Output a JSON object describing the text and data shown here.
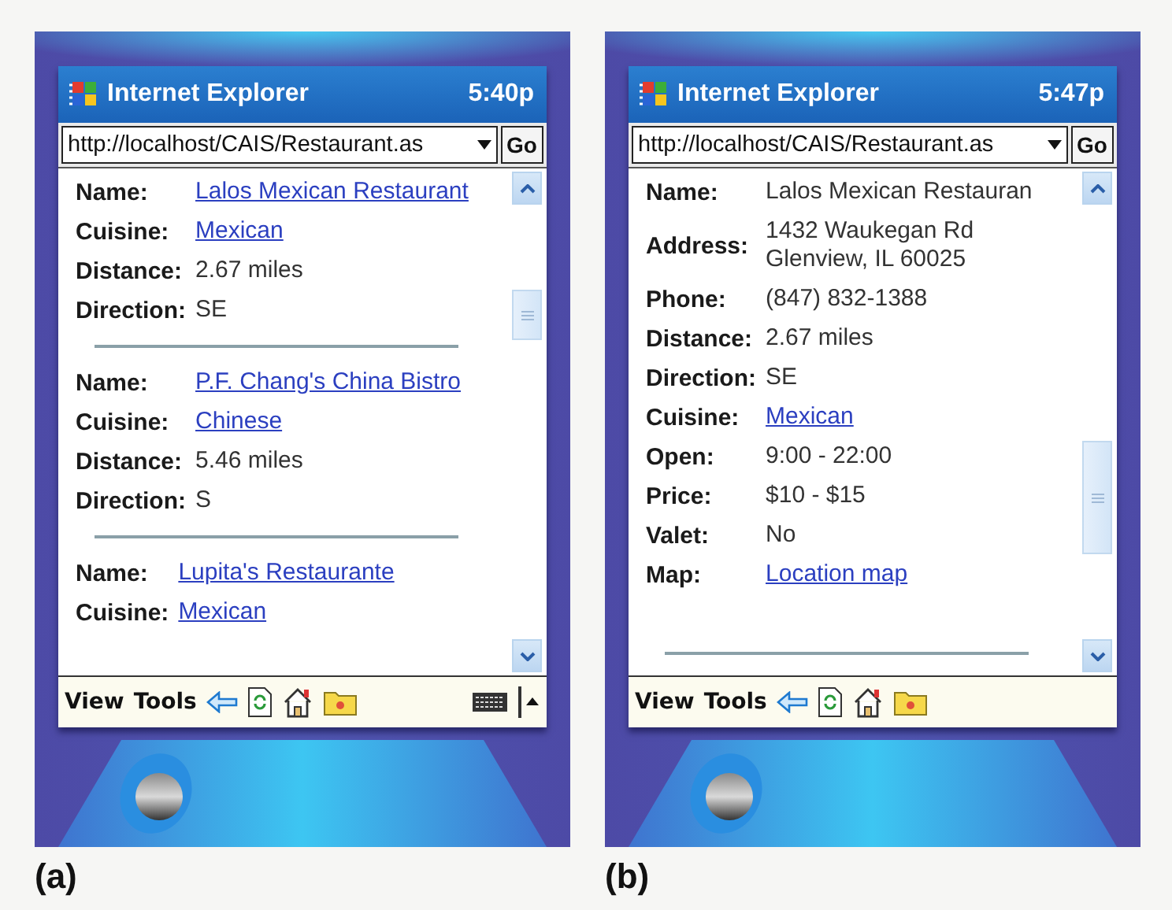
{
  "panels": [
    {
      "label": "(a)",
      "title": "Internet Explorer",
      "time": "5:40p",
      "address": "http://localhost/CAIS/Restaurant.as",
      "go": "Go",
      "trailing_rule": false,
      "input_panel": true,
      "records": [
        {
          "fields": [
            {
              "label": "Name:",
              "value": "Lalos Mexican Restaurant",
              "kind": "link"
            },
            {
              "label": "Cuisine:",
              "value": "Mexican",
              "kind": "link"
            },
            {
              "label": "Distance:",
              "value": "2.67 miles",
              "kind": "text"
            },
            {
              "label": "Direction:",
              "value": "SE",
              "kind": "text"
            }
          ]
        },
        {
          "fields": [
            {
              "label": "Name:",
              "value": "P.F. Chang's China Bistro",
              "kind": "link"
            },
            {
              "label": "Cuisine:",
              "value": "Chinese",
              "kind": "link"
            },
            {
              "label": "Distance:",
              "value": "5.46 miles",
              "kind": "text"
            },
            {
              "label": "Direction:",
              "value": "S",
              "kind": "text"
            }
          ]
        },
        {
          "fields": [
            {
              "label": "Name:",
              "value": "Lupita's Restaurante",
              "kind": "link"
            },
            {
              "label": "Cuisine:",
              "value": "Mexican",
              "kind": "link"
            }
          ]
        }
      ],
      "menu": [
        "View",
        "Tools"
      ]
    },
    {
      "label": "(b)",
      "title": "Internet Explorer",
      "time": "5:47p",
      "address": "http://localhost/CAIS/Restaurant.as",
      "go": "Go",
      "trailing_rule": true,
      "input_panel": false,
      "records": [
        {
          "fields": [
            {
              "label": "Name:",
              "value": "Lalos Mexican Restauran",
              "kind": "text"
            },
            {
              "label": "Address:",
              "value": "1432 Waukegan Rd\nGlenview, IL 60025",
              "kind": "text"
            },
            {
              "label": "Phone:",
              "value": "(847) 832-1388",
              "kind": "text"
            },
            {
              "label": "Distance:",
              "value": "2.67 miles",
              "kind": "text"
            },
            {
              "label": "Direction:",
              "value": "SE",
              "kind": "text"
            },
            {
              "label": "Cuisine:",
              "value": "Mexican",
              "kind": "link"
            },
            {
              "label": "Open:",
              "value": "9:00 - 22:00",
              "kind": "text"
            },
            {
              "label": "Price:",
              "value": "$10 - $15",
              "kind": "text"
            },
            {
              "label": "Valet:",
              "value": "No",
              "kind": "text"
            },
            {
              "label": "Map:",
              "value": "Location map",
              "kind": "link"
            }
          ]
        }
      ],
      "menu": [
        "View",
        "Tools"
      ]
    }
  ]
}
